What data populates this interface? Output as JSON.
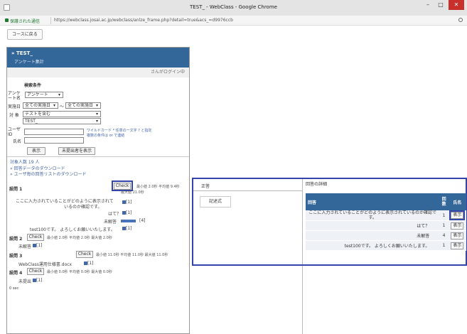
{
  "window": {
    "title": "TEST_ - WebClass - Google Chrome",
    "minimize": "–",
    "maximize": "□",
    "close": "✕"
  },
  "address": {
    "secure_label": "保護された通信",
    "url": "https://webclass.josai.ac.jp/webclass/anlze_frame.php?detail=true&acs_=d9976ccb"
  },
  "toolbar": {
    "back_label": "コースに戻る"
  },
  "left": {
    "title": "» TEST_",
    "subtitle": "アンケート集計",
    "login_text": "さんがログイン中",
    "search": {
      "heading": "検索条件",
      "survey_label": "アンケート名",
      "survey_value": "アンケート",
      "date_label": "実施日",
      "date_from": "全ての実施日",
      "date_sep": "～",
      "date_to": "全ての実施日",
      "target_label": "対 象",
      "target_value": "テストを含む",
      "target_sub": "TEST_",
      "user_label": "ユーザID",
      "name_label": "氏名",
      "hint1": "ワイルドカード * 任意の一文字 ? と指定",
      "hint2": "複数の条件は or で連結",
      "show_btn": "表示",
      "unsubmitted_btn": "未提出者を表示"
    },
    "results": {
      "count": "対象人数 19 人",
      "link1": "» 回答データのダウンロード",
      "link2": "» ユーザ毎の回答リストのダウンロード",
      "q1": {
        "label": "設問 1",
        "check": "Check",
        "stats": "最小値 2.0秒  平均値 9.4秒",
        "stats2": "最大値 21.0秒",
        "ans1": "ここに入力されていることがどのように表示されて",
        "ans1b": "いるのか確認です。",
        "ans1_count": "[1]",
        "ans2": "はて？",
        "ans2_count": "[1]",
        "ans3": "未解答",
        "ans3_count": "[4]",
        "ans3_fraction": 0.21,
        "ans4": "test100です。 よろしくお願いいたします。",
        "ans4_count": "[1]"
      },
      "q2": {
        "label": "設問 2",
        "check": "Check",
        "stats": "最小値 2.0秒  平均値 2.0秒  最大値 2.0秒",
        "unanswered": "未解答",
        "count": "[1]"
      },
      "q3": {
        "label": "設問 3",
        "check": "Check",
        "stats": "最小値 11.0秒  平均値 11.0秒  最大値 11.0秒",
        "file": "WebClass運用仕様書.docx",
        "count": "[1]"
      },
      "q4": {
        "label": "設問 4",
        "check": "Check",
        "stats": "最小値 0.0秒  平均値 0.0秒  最大値 0.0秒",
        "unsubmitted": "未提出",
        "count": "[1]"
      },
      "footer": "0 sec"
    }
  },
  "right": {
    "correct_label": "正答",
    "correct_value": "記述式",
    "answer_label": "回答の詳細",
    "table": {
      "col_answer": "回答",
      "col_count": "回数",
      "col_name": "氏名",
      "rows": [
        {
          "answer": "ここに入力されていることがどのように表示されているのか確認です。",
          "count": "1",
          "button": "表示"
        },
        {
          "answer": "はて？",
          "count": "1",
          "button": "表示"
        },
        {
          "answer": "未解答",
          "count": "4",
          "button": "表示"
        },
        {
          "answer": "test100です。 よろしくお願いいたします。",
          "count": "1",
          "button": "表示"
        }
      ]
    }
  },
  "colors": {
    "header_blue": "#336699",
    "highlight": "#3344aa"
  }
}
